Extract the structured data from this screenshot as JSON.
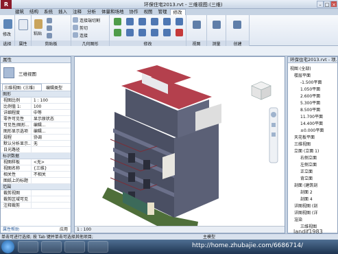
{
  "window": {
    "title": "环保住宅2013.rvt - 三维视图:(三维)"
  },
  "tabs": [
    "建筑",
    "结构",
    "系统",
    "插入",
    "注释",
    "分析",
    "体量和场地",
    "协作",
    "视图",
    "管理",
    "修改"
  ],
  "ribbon": {
    "panels": [
      "选择",
      "属性",
      "剪贴板",
      "几何图形",
      "修改",
      "视图",
      "测量",
      "创建"
    ],
    "modify_label": "修改",
    "paste_label": "粘贴",
    "cut_label": "剪切",
    "join_label": "连接",
    "connect_label": "连接端切割",
    "cut2_label": "剪切"
  },
  "properties": {
    "title": "属性",
    "type_name": "三维视图",
    "selector": "三维视图: (三维)",
    "edit_type": "编辑类型",
    "groups": {
      "graphics": "图形",
      "id": "标识数据",
      "range": "范围"
    },
    "rows_graphics": [
      {
        "k": "视图比例",
        "v": "1 : 100"
      },
      {
        "k": "比例值 1:",
        "v": "100"
      },
      {
        "k": "详细程度",
        "v": "中等"
      },
      {
        "k": "零件可见性",
        "v": "显示原状态"
      },
      {
        "k": "可见性/图形...",
        "v": "编辑..."
      },
      {
        "k": "图形显示选项",
        "v": "编辑..."
      },
      {
        "k": "规程",
        "v": "协调"
      },
      {
        "k": "默认分析显示...",
        "v": "无"
      },
      {
        "k": "日光路径",
        "v": ""
      }
    ],
    "rows_id": [
      {
        "k": "视图样板",
        "v": "<无>"
      },
      {
        "k": "视图名称",
        "v": "{三维}"
      },
      {
        "k": "相关性",
        "v": "不相关"
      },
      {
        "k": "图纸上的标题",
        "v": ""
      }
    ],
    "rows_range": [
      {
        "k": "裁剪视图",
        "v": ""
      },
      {
        "k": "裁剪区域可见",
        "v": ""
      },
      {
        "k": "注释裁剪",
        "v": ""
      }
    ],
    "help": "属性帮助",
    "apply": "应用"
  },
  "browser": {
    "title": "环保住宅2013.rvt - 项...",
    "items": [
      "视图 (全部)",
      "楼层平面",
      "-1.500平面",
      "1.050平面",
      "2.600平面",
      "5.300平面",
      "8.500平面",
      "11.700平面",
      "14.400平面",
      "±0.000平面",
      "天花板平面",
      "三维视图",
      "立面 (立面 1)",
      "右侧立面",
      "左侧立面",
      "正立面",
      "背立面",
      "剖面 (建筑剖",
      "剖面 2",
      "剖面 4",
      "详图视图 (剖",
      "详图视图 (详",
      "渲染",
      "三维视图"
    ]
  },
  "view_controls": {
    "scale": "1 : 100"
  },
  "status": {
    "text": "单击可进行选择; 按 Tab 键并单击可选择其他项目;",
    "model": "主模型"
  },
  "watermark": "landif1983",
  "url": "http://home.zhubajie.com/6686714/",
  "colors": {
    "accent": "#2c5d9b",
    "wall": "#4a4f63",
    "roof": "#b4404d"
  }
}
